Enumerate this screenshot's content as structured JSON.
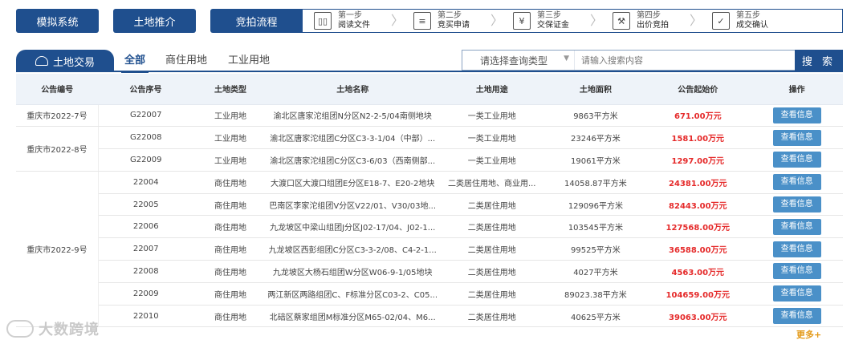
{
  "nav": {
    "items": [
      "模拟系统",
      "土地推介",
      "竞拍流程"
    ]
  },
  "steps": [
    {
      "label": "第一步",
      "desc": "阅读文件",
      "icon": "book-icon"
    },
    {
      "label": "第二步",
      "desc": "竞买申请",
      "icon": "document-icon"
    },
    {
      "label": "第三步",
      "desc": "交保证金",
      "icon": "deposit-icon"
    },
    {
      "label": "第四步",
      "desc": "出价竞拍",
      "icon": "gavel-icon"
    },
    {
      "label": "第五步",
      "desc": "成交确认",
      "icon": "confirm-icon"
    }
  ],
  "tabs": {
    "main": "土地交易",
    "sub": [
      "全部",
      "商住用地",
      "工业用地"
    ]
  },
  "search": {
    "select_placeholder": "请选择查询类型",
    "input_placeholder": "请输入搜索内容",
    "button": "搜 索"
  },
  "table": {
    "headers": [
      "公告编号",
      "公告序号",
      "土地类型",
      "土地名称",
      "土地用途",
      "土地面积",
      "公告起始价",
      "操作"
    ],
    "groups": [
      "重庆市2022-7号",
      "重庆市2022-8号",
      "重庆市2022-9号"
    ],
    "rows": [
      {
        "seq": "G22007",
        "type": "工业用地",
        "name": "渝北区唐家沱组团N分区N2-2-5/04南侧地块",
        "use": "一类工业用地",
        "area": "9863平方米",
        "price": "671.00万元"
      },
      {
        "seq": "G22008",
        "type": "工业用地",
        "name": "渝北区唐家沱组团C分区C3-3-1/04（中部）...",
        "use": "一类工业用地",
        "area": "23246平方米",
        "price": "1581.00万元"
      },
      {
        "seq": "G22009",
        "type": "工业用地",
        "name": "渝北区唐家沱组团C分区C3-6/03（西南侧部...",
        "use": "一类工业用地",
        "area": "19061平方米",
        "price": "1297.00万元"
      },
      {
        "seq": "22004",
        "type": "商住用地",
        "name": "大渡口区大渡口组团E分区E18-7、E20-2地块",
        "use": "二类居住用地、商业用...",
        "area": "14058.87平方米",
        "price": "24381.00万元"
      },
      {
        "seq": "22005",
        "type": "商住用地",
        "name": "巴南区李家沱组团V分区V22/01、V30/03地...",
        "use": "二类居住用地",
        "area": "129096平方米",
        "price": "82443.00万元"
      },
      {
        "seq": "22006",
        "type": "商住用地",
        "name": "九龙坡区中梁山组团J分区J02-17/04、J02-1...",
        "use": "二类居住用地",
        "area": "103545平方米",
        "price": "127568.00万元"
      },
      {
        "seq": "22007",
        "type": "商住用地",
        "name": "九龙坡区西彭组团C分区C3-3-2/08、C4-2-1...",
        "use": "二类居住用地",
        "area": "99525平方米",
        "price": "36588.00万元"
      },
      {
        "seq": "22008",
        "type": "商住用地",
        "name": "九龙坡区大杨石组团W分区W06-9-1/05地块",
        "use": "二类居住用地",
        "area": "4027平方米",
        "price": "4563.00万元"
      },
      {
        "seq": "22009",
        "type": "商住用地",
        "name": "两江新区两路组团C、F标准分区C03-2、C05...",
        "use": "二类居住用地",
        "area": "89023.38平方米",
        "price": "104659.00万元"
      },
      {
        "seq": "22010",
        "type": "商住用地",
        "name": "北碚区蔡家组团M标准分区M65-02/04、M6...",
        "use": "二类居住用地",
        "area": "40625平方米",
        "price": "39063.00万元"
      }
    ],
    "action_label": "查看信息"
  },
  "more": "更多+",
  "watermark": "大数跨境",
  "colors": {
    "primary": "#1f4f8e",
    "button": "#4a90c8",
    "price": "#e52a2a",
    "more": "#e39a1a"
  }
}
